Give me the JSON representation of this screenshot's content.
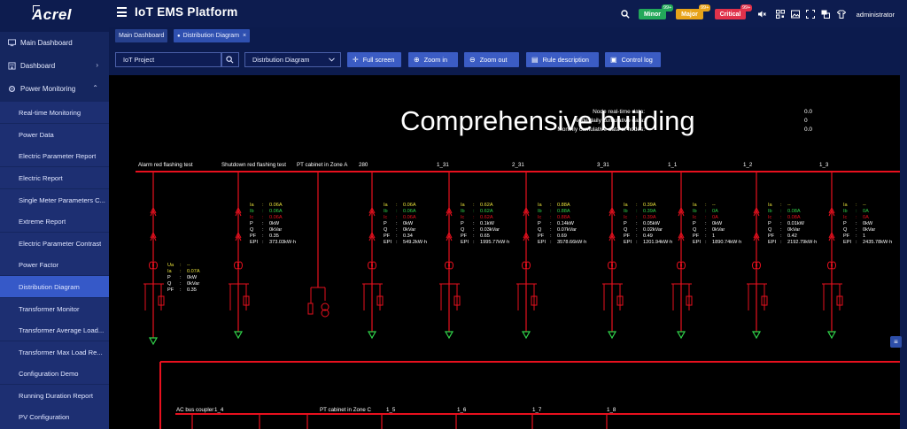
{
  "brand": {
    "logo_text": "Acrel"
  },
  "app": {
    "title": "IoT EMS Platform"
  },
  "alarms": [
    {
      "label": "Minor",
      "count": "99+",
      "color": "#23a85a"
    },
    {
      "label": "Major",
      "count": "99+",
      "color": "#e8a31a"
    },
    {
      "label": "Critical",
      "count": "99+",
      "color": "#e0324b"
    }
  ],
  "user": {
    "name": "administrator"
  },
  "sidebar": {
    "top_items": [
      {
        "label": "Main Dashboard",
        "icon": "monitor-icon"
      },
      {
        "label": "Dashboard",
        "icon": "building-icon",
        "chevron": "›"
      },
      {
        "label": "Power Monitoring",
        "icon": "gear-icon",
        "chevron": "⌃"
      }
    ],
    "sub_items": [
      {
        "label": "Real-time Monitoring"
      },
      {
        "label": "Power Data"
      },
      {
        "label": "Electric Parameter Report"
      },
      {
        "label": "Electric Report"
      },
      {
        "label": "Single Meter Parameters C..."
      },
      {
        "label": "Extreme Report"
      },
      {
        "label": "Electric Parameter Contrast"
      },
      {
        "label": "Power Factor"
      },
      {
        "label": "Distribution Diagram",
        "active": true
      },
      {
        "label": "Transformer Monitor"
      },
      {
        "label": "Transformer Average Load..."
      },
      {
        "label": "Transformer Max Load Re..."
      },
      {
        "label": "Configuration Demo"
      },
      {
        "label": "Running Duration Report"
      },
      {
        "label": "PV Configuration"
      }
    ]
  },
  "tabs": [
    {
      "label": "Main Dashboard"
    },
    {
      "label": "Distribution Diagram",
      "close": "×"
    }
  ],
  "toolbar": {
    "project_value": "IoT Project",
    "diagram_value": "Distrbution Diagram",
    "buttons": [
      {
        "label": "Full screen",
        "icon": "expand-icon",
        "glyph": "✛"
      },
      {
        "label": "Zoom in",
        "icon": "zoom-in-icon",
        "glyph": "⊕"
      },
      {
        "label": "Zoom out",
        "icon": "zoom-out-icon",
        "glyph": "⊖"
      },
      {
        "label": "Rule description",
        "icon": "document-icon",
        "glyph": "▤"
      },
      {
        "label": "Control log",
        "icon": "log-icon",
        "glyph": "▣"
      }
    ]
  },
  "diagram": {
    "title": "Comprehensive building",
    "summary": [
      {
        "label": "Node real-time data:",
        "value": "0.0"
      },
      {
        "label": "Node daily cumulative data:",
        "value": "0"
      },
      {
        "label": "Monthly cumulative data of nodes:",
        "value": "0.0"
      }
    ],
    "colors": {
      "bus": "#e8101e",
      "green": "#31d24a",
      "yellow": "#e9e23a",
      "white": "#ffffff"
    },
    "top_labels": [
      "Alarm red flashing test",
      "Shutdown red flashing test",
      "PT cabinet in Zone A",
      "280",
      "1_31",
      "2_31",
      "3_31",
      "1_1",
      "1_2",
      "1_3"
    ],
    "bottom_labels": [
      "AC bus coupler",
      "1_4",
      "PT cabinet in Zone C",
      "1_5",
      "1_6",
      "1_7",
      "1_8"
    ],
    "feeders": [
      {
        "Ia": "--",
        "Ib": "--",
        "Ic": "--",
        "Ua": "--",
        "Ia2": "0.07A",
        "P": "0kW",
        "Q": "0kVar",
        "PF": "0.35",
        "EPI": ""
      },
      {
        "Ia": "0.06A",
        "Ib": "0.06A",
        "Ic": "0.06A",
        "P": "0kW",
        "Q": "0kVar",
        "PF": "0.35",
        "EPI": "373.03kW·h"
      },
      {
        "Ia": "0.06A",
        "Ib": "0.06A",
        "Ic": "0.06A",
        "P": "0kW",
        "Q": "0kVar",
        "PF": "0.34",
        "EPI": "549.2kW·h"
      },
      {
        "Ia": "0.62A",
        "Ib": "0.62A",
        "Ic": "0.62A",
        "P": "0.1kW",
        "Q": "0.03kVar",
        "PF": "0.65",
        "EPI": "1995.77kW·h"
      },
      {
        "Ia": "0.88A",
        "Ib": "0.88A",
        "Ic": "0.88A",
        "P": "0.14kW",
        "Q": "0.07kVar",
        "PF": "0.69",
        "EPI": "3578.66kW·h"
      },
      {
        "Ia": "0.39A",
        "Ib": "0.39A",
        "Ic": "0.39A",
        "P": "0.05kW",
        "Q": "0.02kVar",
        "PF": "0.49",
        "EPI": "1201.94kW·h"
      },
      {
        "Ia": "--",
        "Ib": "0A",
        "Ic": "0A",
        "P": "0kW",
        "Q": "0kVar",
        "PF": "1",
        "EPI": "1890.74kW·h"
      },
      {
        "Ia": "--",
        "Ib": "0.08A",
        "Ic": "0.08A",
        "P": "0.01kW",
        "Q": "0kVar",
        "PF": "0.42",
        "EPI": "2192.79kW·h"
      },
      {
        "Ia": "--",
        "Ib": "0A",
        "Ic": "0A",
        "P": "0kW",
        "Q": "0kVar",
        "PF": "1",
        "EPI": "2435.78kW·h"
      }
    ],
    "row_keys": {
      "Ia": "Ia",
      "Ib": "Ib",
      "Ic": "Ic",
      "Ua": "Ua",
      "P": "P",
      "Q": "Q",
      "PF": "PF",
      "EPI": "EPI",
      "sep": ":"
    }
  }
}
